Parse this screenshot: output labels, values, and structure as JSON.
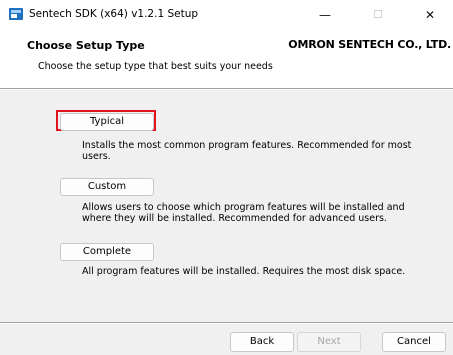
{
  "window": {
    "title": "Sentech SDK (x64) v1.2.1 Setup",
    "minimize_glyph": "—",
    "maximize_glyph": "☐",
    "close_glyph": "✕"
  },
  "header": {
    "title": "Choose Setup Type",
    "company": "OMRON SENTECH CO., LTD.",
    "subtitle": "Choose the setup type that best suits your needs"
  },
  "options": [
    {
      "label": "Typical",
      "description": "Installs the most common program features. Recommended for most users."
    },
    {
      "label": "Custom",
      "description": "Allows users to choose which program features will be installed and where they will be installed. Recommended for advanced users."
    },
    {
      "label": "Complete",
      "description": "All program features will be installed. Requires the most disk space."
    }
  ],
  "footer": {
    "back_label": "Back",
    "next_label": "Next",
    "cancel_label": "Cancel"
  },
  "state": {
    "focused_option": "Typical",
    "next_enabled": false
  },
  "colors": {
    "focus_ring": "#e0131f",
    "icon_blue": "#1f6fbf",
    "disabled_text": "#a6a6a6"
  }
}
